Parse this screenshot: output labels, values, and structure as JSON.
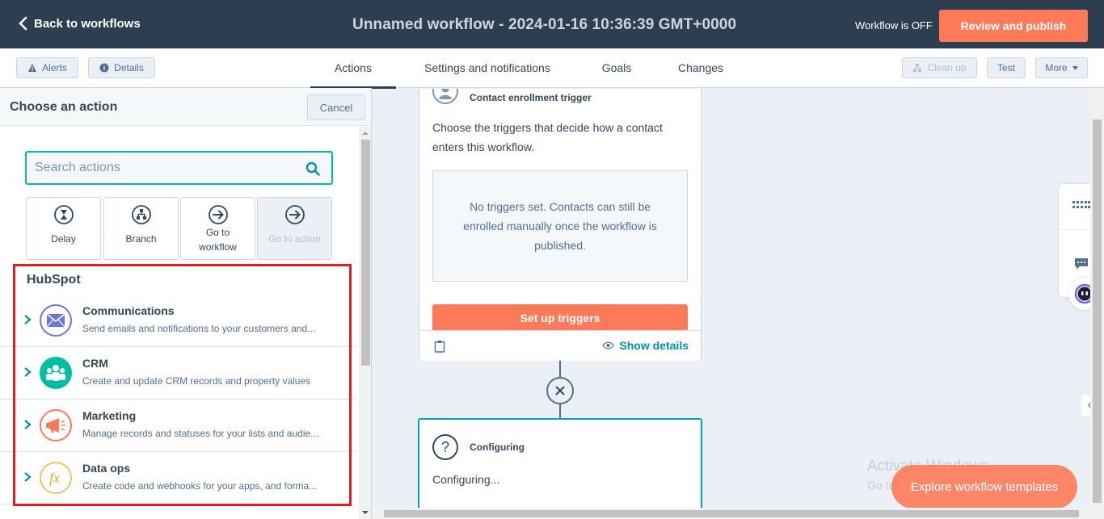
{
  "topbar": {
    "back_label": "Back to workflows",
    "title": "Unnamed workflow - 2024-01-16 10:36:39 GMT+0000",
    "status": "Workflow is OFF",
    "review_label": "Review and publish"
  },
  "tabbar": {
    "alerts_label": "Alerts",
    "details_label": "Details",
    "tabs": [
      {
        "label": "Actions"
      },
      {
        "label": "Settings and notifications"
      },
      {
        "label": "Goals"
      },
      {
        "label": "Changes"
      }
    ],
    "cleanup_label": "Clean up",
    "test_label": "Test",
    "more_label": "More"
  },
  "panel": {
    "title": "Choose an action",
    "cancel_label": "Cancel",
    "search_placeholder": "Search actions",
    "tiles": [
      {
        "label": "Delay",
        "icon": "hourglass-icon"
      },
      {
        "label": "Branch",
        "icon": "branch-icon"
      },
      {
        "label": "Go to workflow",
        "icon": "arrow-circle-icon"
      },
      {
        "label": "Go to action",
        "icon": "arrow-circle-icon"
      }
    ],
    "section_title": "HubSpot",
    "categories": [
      {
        "name": "Communications",
        "desc": "Send emails and notifications to your customers and...",
        "icon": "envelope-icon",
        "color": "#6a78d1"
      },
      {
        "name": "CRM",
        "desc": "Create and update CRM records and property values",
        "icon": "people-icon",
        "color": "#00bda5"
      },
      {
        "name": "Marketing",
        "desc": "Manage records and statuses for your lists and audie...",
        "icon": "megaphone-icon",
        "color": "#ff7a59"
      },
      {
        "name": "Data ops",
        "desc": "Create code and webhooks for your apps, and forma...",
        "icon": "function-icon",
        "color": "#f5c26b"
      }
    ]
  },
  "canvas": {
    "trigger_label": "Contact enrollment trigger",
    "trigger_text": "Choose the triggers that decide how a contact enters this workflow.",
    "empty_text": "No triggers set. Contacts can still be enrolled manually once the workflow is published.",
    "setup_label": "Set up triggers",
    "show_details_label": "Show details",
    "config_label": "Configuring",
    "config_text": "Configuring...",
    "explore_label": "Explore workflow templates",
    "watermark_line1": "Activate Windows",
    "watermark_line2": "Go to"
  },
  "colors": {
    "topbar_bg": "#2d3e50",
    "accent_orange": "#ff7a59",
    "accent_teal": "#00bda5",
    "link_blue": "#0091ae",
    "highlight_red": "#e31b23"
  }
}
